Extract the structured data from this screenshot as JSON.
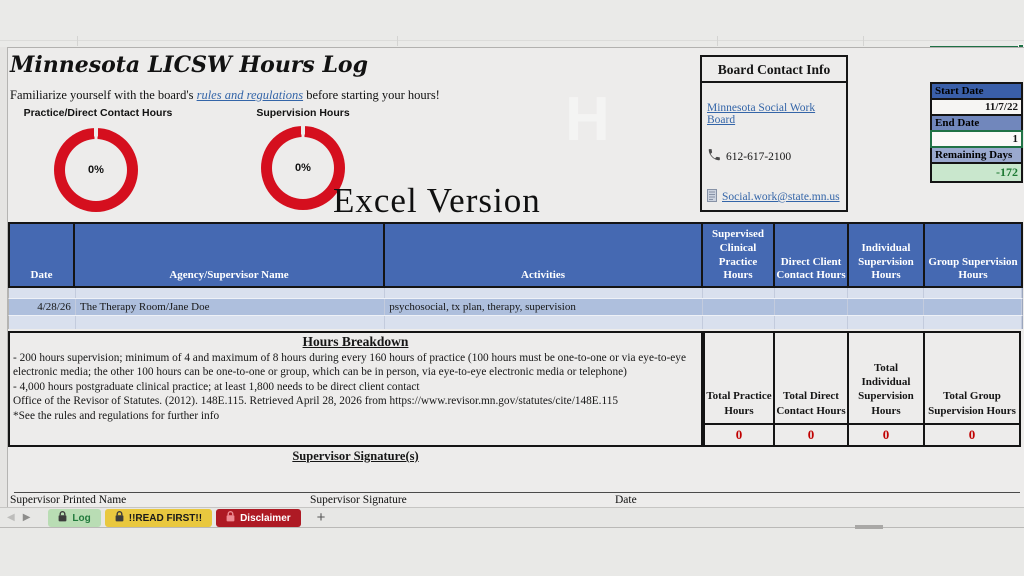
{
  "overlay": {
    "excel_version": "Excel Version",
    "watermark": "H"
  },
  "header": {
    "title": "Minnesota LICSW Hours Log",
    "subtitle_prefix": "Familiarize yourself with the board's ",
    "subtitle_link": "rules and regulations",
    "subtitle_suffix": " before starting your hours!"
  },
  "gauges": [
    {
      "label": "Practice/Direct Contact Hours",
      "percent": "0%"
    },
    {
      "label": "Supervision Hours",
      "percent": "0%"
    }
  ],
  "contact": {
    "title": "Board Contact Info",
    "link": "Minnesota Social Work Board",
    "phone": "612-617-2100",
    "email": "Social.work@state.mn.us"
  },
  "dates": {
    "start_label": "Start Date",
    "start_value": "11/7/22",
    "end_label": "End Date",
    "end_value": "1",
    "remaining_label": "Remaining Days",
    "remaining_value": "-172"
  },
  "log_table": {
    "columns": [
      "Date",
      "Agency/Supervisor Name",
      "Activities",
      "Supervised Clinical Practice Hours",
      "Direct Client Contact Hours",
      "Individual Supervision Hours",
      "Group Supervision Hours"
    ],
    "rows": [
      {
        "date": "4/28/26",
        "agency_supervisor": "The Therapy Room/Jane Doe",
        "activities": "psychosocial, tx plan, therapy, supervision",
        "supervised_clinical_practice_hours": "",
        "direct_client_contact_hours": "",
        "individual_supervision_hours": "",
        "group_supervision_hours": ""
      }
    ]
  },
  "breakdown": {
    "title": "Hours Breakdown",
    "lines": [
      "- 200 hours supervision; minimum of 4 and maximum of 8 hours during every 160 hours of practice (100 hours must be one-to-one or via eye-to-eye electronic media; the other 100 hours can be one-to-one or group, which can be in person, via eye-to-eye electronic media or telephone)",
      "- 4,000 hours postgraduate clinical practice; at least 1,800 needs to be direct client contact",
      "Office of the Revisor of Statutes. (2012). 148E.115. Retrieved April 28, 2026 from https://www.revisor.mn.gov/statutes/cite/148E.115",
      "*See the rules and regulations for further info"
    ]
  },
  "totals": [
    {
      "label": "Total Practice Hours",
      "value": "0"
    },
    {
      "label": "Total Direct Contact Hours",
      "value": "0"
    },
    {
      "label": "Total Individual Supervision Hours",
      "value": "0"
    },
    {
      "label": "Total Group Supervision Hours",
      "value": "0"
    }
  ],
  "signature": {
    "heading": "Supervisor Signature(s)",
    "printed_name_label": "Supervisor Printed Name",
    "signature_label": "Supervisor Signature",
    "date_label": "Date"
  },
  "tabs": {
    "prev_icon": "◀",
    "next_icon": "▶",
    "items": [
      {
        "label": "Log"
      },
      {
        "label": "!!READ FIRST!!"
      },
      {
        "label": "Disclaimer"
      }
    ],
    "add_label": "+"
  }
}
